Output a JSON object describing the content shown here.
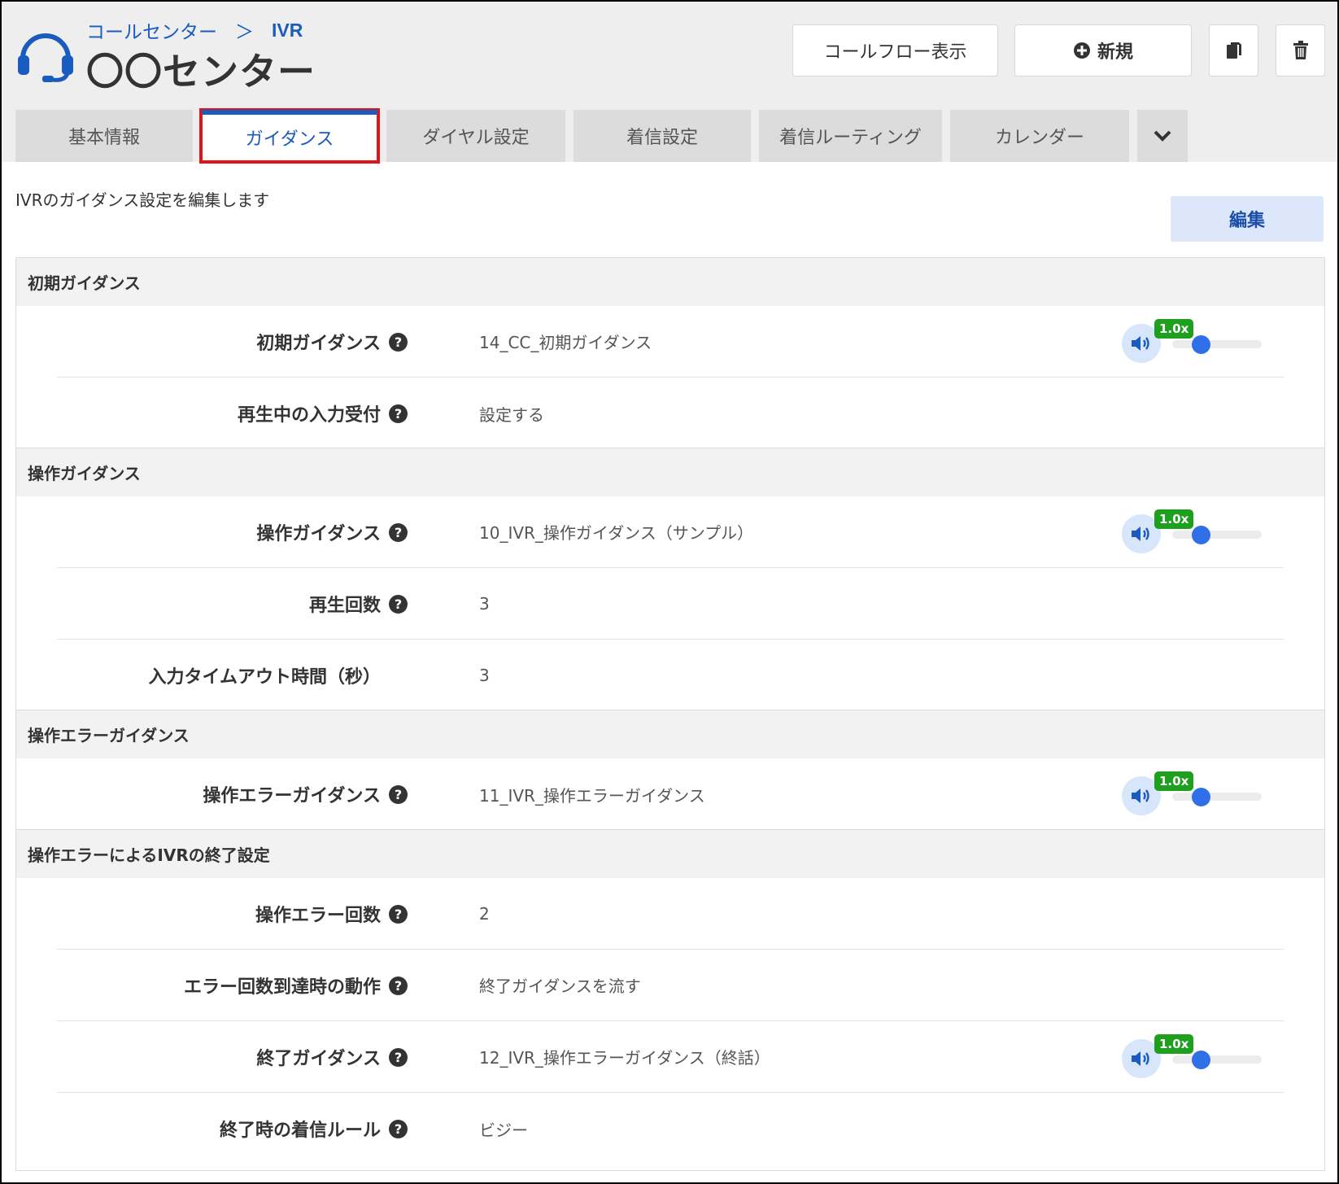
{
  "header": {
    "breadcrumb": [
      "コールセンター",
      "＞",
      "IVR"
    ],
    "title": "〇〇センター",
    "buttons": {
      "callflow": "コールフロー表示",
      "new": "新規"
    }
  },
  "tabs": [
    {
      "label": "基本情報"
    },
    {
      "label": "ガイダンス"
    },
    {
      "label": "ダイヤル設定"
    },
    {
      "label": "着信設定"
    },
    {
      "label": "着信ルーティング"
    },
    {
      "label": "カレンダー"
    }
  ],
  "main": {
    "description": "IVRのガイダンス設定を編集します",
    "edit_label": "編集",
    "sections": [
      {
        "title": "初期ガイダンス",
        "rows": [
          {
            "label": "初期ガイダンス",
            "value": "14_CC_初期ガイダンス",
            "speed": "1.0x",
            "volume_level": 0.25
          },
          {
            "label": "再生中の入力受付",
            "value": "設定する"
          }
        ]
      },
      {
        "title": "操作ガイダンス",
        "rows": [
          {
            "label": "操作ガイダンス",
            "value": "10_IVR_操作ガイダンス（サンプル）",
            "speed": "1.0x",
            "volume_level": 0.25
          },
          {
            "label": "再生回数",
            "value": "3"
          },
          {
            "label": "入力タイムアウト時間（秒）",
            "value": "3"
          }
        ]
      },
      {
        "title": "操作エラーガイダンス",
        "rows": [
          {
            "label": "操作エラーガイダンス",
            "value": "11_IVR_操作エラーガイダンス",
            "speed": "1.0x",
            "volume_level": 0.25
          }
        ]
      },
      {
        "title": "操作エラーによるIVRの終了設定",
        "rows": [
          {
            "label": "操作エラー回数",
            "value": "2"
          },
          {
            "label": "エラー回数到達時の動作",
            "value": "終了ガイダンスを流す"
          },
          {
            "label": "終了ガイダンス",
            "value": "12_IVR_操作エラーガイダンス（終話）",
            "speed": "1.0x",
            "volume_level": 0.25
          },
          {
            "label": "終了時の着信ルール",
            "value": "ビジー"
          }
        ]
      }
    ]
  },
  "colors": {
    "accent": "#1a5bbf",
    "active_tab_outline": "#e0141d",
    "speed_badge": "#1ea01e",
    "slider_thumb": "#2f6fe8"
  }
}
